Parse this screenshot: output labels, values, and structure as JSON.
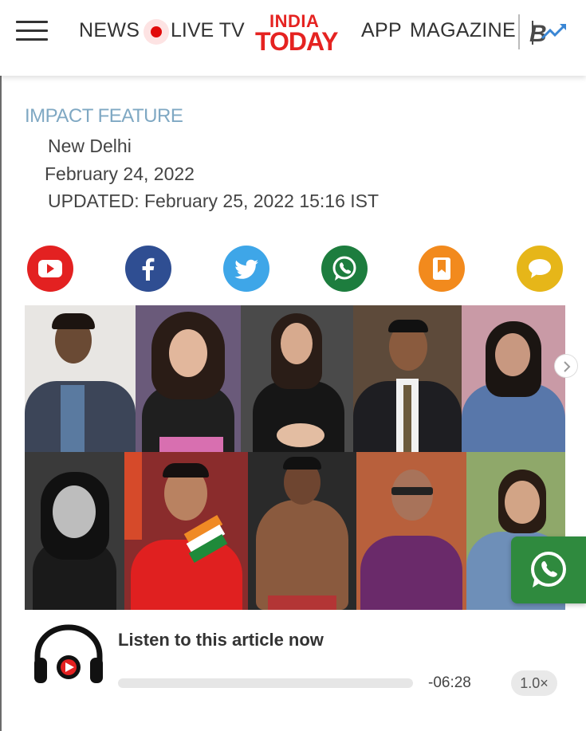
{
  "header": {
    "nav": {
      "news": "NEWS",
      "live_tv": "LIVE TV",
      "app": "APP",
      "magazine": "MAGAZINE"
    },
    "logo": {
      "line1": "INDIA",
      "line2": "TODAY"
    },
    "icons": [
      "menu-icon",
      "live-dot-icon",
      "crypto-trend-icon"
    ]
  },
  "article": {
    "label": "IMPACT FEATURE",
    "city": "New Delhi",
    "date": "February 24, 2022",
    "updated": "UPDATED: February 25, 2022 15:16 IST"
  },
  "share": [
    "youtube-icon",
    "facebook-icon",
    "twitter-icon",
    "whatsapp-icon",
    "bookmark-icon",
    "comment-icon"
  ],
  "audio": {
    "title": "Listen to this article now",
    "remaining": "-06:28",
    "speed": "1.0×",
    "progress": 0
  },
  "colors": {
    "brand_red": "#e52321",
    "live_red": "#e10b0b",
    "impact_blue": "#7fa8c3",
    "whatsapp_green": "#2f8a3e"
  }
}
